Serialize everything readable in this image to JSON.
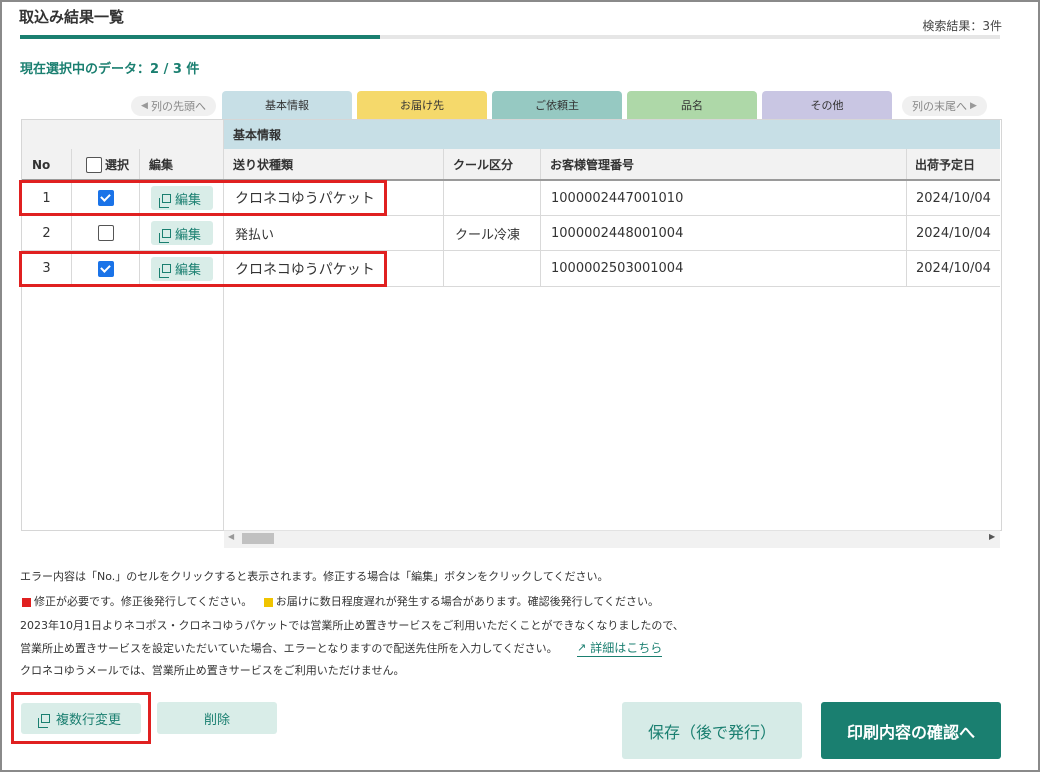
{
  "header": {
    "title": "取込み結果一覧",
    "result_count": "検索結果：3件",
    "selection": "現在選択中のデータ：2 / 3 件"
  },
  "tabs": {
    "prev": "列の先頭へ",
    "next": "列の末尾へ",
    "items": [
      {
        "label": "基本情報",
        "color": "#c7dfe6"
      },
      {
        "label": "お届け先",
        "color": "#f5d96b"
      },
      {
        "label": "ご依頼主",
        "color": "#96c9c2"
      },
      {
        "label": "品名",
        "color": "#aed8a8"
      },
      {
        "label": "その他",
        "color": "#c9c6e3"
      }
    ]
  },
  "table": {
    "fixed_headers": {
      "no": "No",
      "select": "選択",
      "edit": "編集"
    },
    "group_header": "基本情報",
    "columns": [
      "送り状種類",
      "クール区分",
      "お客様管理番号",
      "出荷予定日"
    ],
    "edit_label": "編集",
    "rows": [
      {
        "no": "1",
        "checked": true,
        "type": "クロネコゆうパケット",
        "cool": "",
        "customer_no": "1000002447001010",
        "date": "2024/10/04"
      },
      {
        "no": "2",
        "checked": false,
        "type": "発払い",
        "cool": "クール冷凍",
        "customer_no": "1000002448001004",
        "date": "2024/10/04"
      },
      {
        "no": "3",
        "checked": true,
        "type": "クロネコゆうパケット",
        "cool": "",
        "customer_no": "1000002503001004",
        "date": "2024/10/04"
      }
    ]
  },
  "notes": {
    "line1": "エラー内容は「No.」のセルをクリックすると表示されます。修正する場合は「編集」ボタンをクリックしてください。",
    "legend_red": "修正が必要です。修正後発行してください。",
    "legend_yellow": "お届けに数日程度遅れが発生する場合があります。確認後発行してください。",
    "line3": "2023年10月1日よりネコポス・クロネコゆうパケットでは営業所止め置きサービスをご利用いただくことができなくなりましたので、",
    "line4": "営業所止め置きサービスを設定いただいていた場合、エラーとなりますので配送先住所を入力してください。",
    "detail_link": "詳細はこちら",
    "line5": "クロネコゆうメールでは、営業所止め置きサービスをご利用いただけません。",
    "red_color": "#e02020",
    "yellow_color": "#f0c400"
  },
  "buttons": {
    "multi_edit": "複数行変更",
    "delete": "削除",
    "save": "保存（後で発行）",
    "confirm": "印刷内容の確認へ"
  }
}
